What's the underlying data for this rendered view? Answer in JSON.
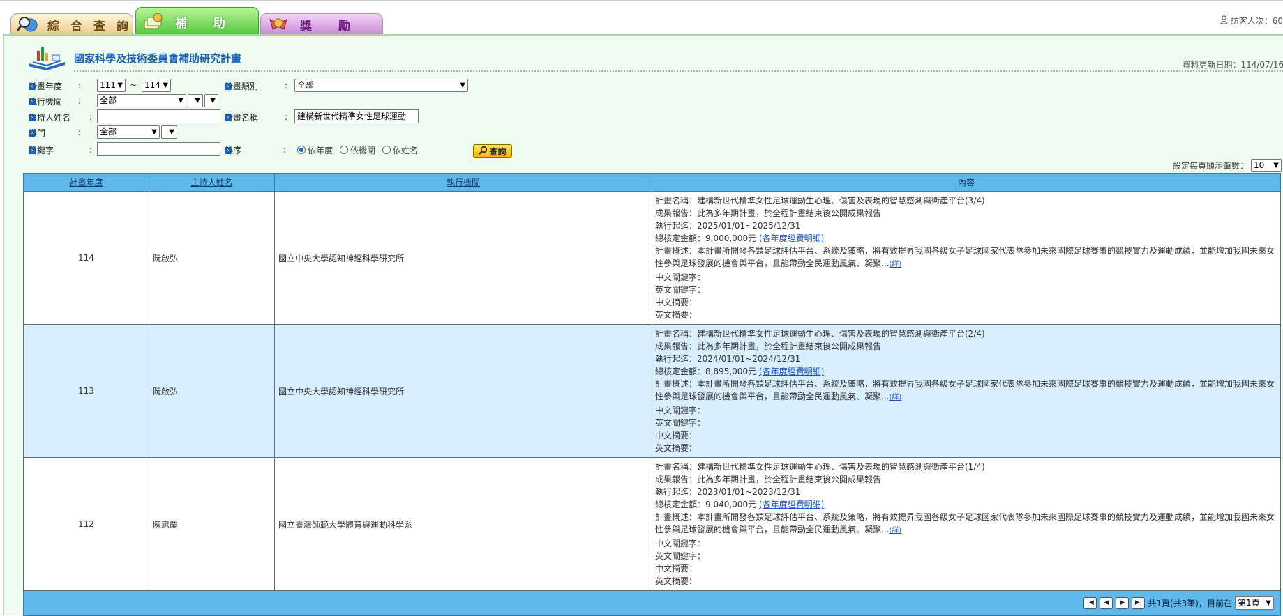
{
  "tabs": [
    {
      "label": "綜合查詢"
    },
    {
      "label": "補 助"
    },
    {
      "label": "獎 勵"
    }
  ],
  "visitor_label": "訪客人次：60",
  "page_title": "國家科學及技術委員會補助研究計畫",
  "update_date": "資料更新日期：114/07/16",
  "form": {
    "year_label": "計畫年度",
    "year_from": "111",
    "year_to": "114",
    "category_label": "計畫類別",
    "category_value": "全部",
    "org_label": "執行機關",
    "org_value": "全部",
    "pi_label": "主持人姓名",
    "pi_value": "",
    "plan_name_label": "計畫名稱",
    "plan_name_value": "建構新世代精準女性足球運動",
    "field_label": "學門",
    "field_value": "全部",
    "keyword_label": "關鍵字",
    "keyword_value": "",
    "sort_label": "排序",
    "sort_options": [
      "依年度",
      "依機關",
      "依姓名"
    ],
    "sort_selected": "依年度",
    "query_button": "查詢",
    "colon": ":",
    "tilde": "~"
  },
  "per_page_label": "設定每頁顯示筆數：",
  "per_page_value": "10",
  "table": {
    "headers": [
      "計畫年度",
      "主持人姓名",
      "執行機關",
      "內容"
    ],
    "rows": [
      {
        "year": "114",
        "pi": "阮啟弘",
        "org": "國立中央大學認知神經科學研究所",
        "plan_name": "計畫名稱：建構新世代精準女性足球運動生心理、傷害及表現的智慧感測與衛產平台(3/4)",
        "report": "成果報告：此為多年期計畫，於全程計畫結束後公開成果報告",
        "period": "執行起迄：2025/01/01~2025/12/31",
        "amount": "總核定金額：9,000,000元",
        "amount_link": "(各年度經費明細)",
        "summary": "計畫概述：本計畫所開發各類足球評估平台、系統及策略，將有效提昇我國各級女子足球國家代表隊參加未來國際足球賽事的競技實力及運動成績，並能增加我國未來女性參與足球發展的機會與平台，且能帶動全民運動風氣、凝聚...",
        "detail_link": "(詳)",
        "kw_zh": "中文關鍵字：",
        "kw_en": "英文關鍵字：",
        "abs_zh": "中文摘要：",
        "abs_en": "英文摘要："
      },
      {
        "year": "113",
        "pi": "阮啟弘",
        "org": "國立中央大學認知神經科學研究所",
        "plan_name": "計畫名稱：建構新世代精準女性足球運動生心理、傷害及表現的智慧感測與衛產平台(2/4)",
        "report": "成果報告：此為多年期計畫，於全程計畫結束後公開成果報告",
        "period": "執行起迄：2024/01/01~2024/12/31",
        "amount": "總核定金額：8,895,000元",
        "amount_link": "(各年度經費明細)",
        "summary": "計畫概述：本計畫所開發各類足球評估平台、系統及策略，將有效提昇我國各級女子足球國家代表隊參加未來國際足球賽事的競技實力及運動成績，並能增加我國未來女性參與足球發展的機會與平台，且能帶動全民運動風氣、凝聚...",
        "detail_link": "(詳)",
        "kw_zh": "中文關鍵字：",
        "kw_en": "英文關鍵字：",
        "abs_zh": "中文摘要：",
        "abs_en": "英文摘要："
      },
      {
        "year": "112",
        "pi": "陳忠慶",
        "org": "國立臺灣師範大學體育與運動科學系",
        "plan_name": "計畫名稱：建構新世代精準女性足球運動生心理、傷害及表現的智慧感測與衛產平台(1/4)",
        "report": "成果報告：此為多年期計畫，於全程計畫結束後公開成果報告",
        "period": "執行起迄：2023/01/01~2023/12/31",
        "amount": "總核定金額：9,040,000元",
        "amount_link": "(各年度經費明細)",
        "summary": "計畫概述：本計畫所開發各類足球評估平台、系統及策略，將有效提昇我國各級女子足球國家代表隊參加未來國際足球賽事的競技實力及運動成績，並能增加我國未來女性參與足球發展的機會與平台，且能帶動全民運動風氣、凝聚...",
        "detail_link": "(詳)",
        "kw_zh": "中文關鍵字：",
        "kw_en": "英文關鍵字：",
        "abs_zh": "中文摘要：",
        "abs_en": "英文摘要："
      }
    ]
  },
  "pager": {
    "summary": "共1頁(共3筆)，目前在",
    "current": "第1頁"
  },
  "colors": {
    "header_blue": "#5fb8ec",
    "panel_green": "#eefbef",
    "alt_row": "#d9efff",
    "title_blue": "#1a5fb4"
  }
}
